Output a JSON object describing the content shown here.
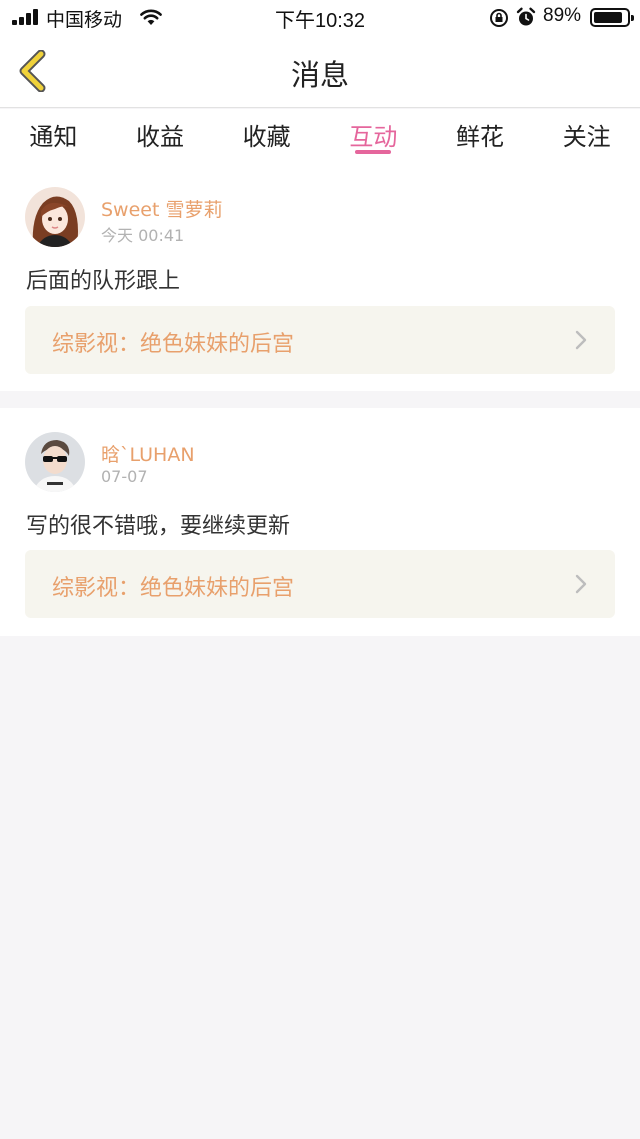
{
  "status_bar": {
    "carrier": "中国移动",
    "time": "下午10:32",
    "battery_percent": "89%",
    "battery_level": 0.89,
    "icons": [
      "signal-icon",
      "wifi-icon",
      "rotation-lock-icon",
      "alarm-icon",
      "battery-icon"
    ]
  },
  "nav": {
    "title": "消息",
    "back_icon": "chevron-left-icon",
    "accent_color": "#f0d23a"
  },
  "tabs": [
    {
      "label": "通知",
      "active": false
    },
    {
      "label": "收益",
      "active": false
    },
    {
      "label": "收藏",
      "active": false
    },
    {
      "label": "互动",
      "active": true
    },
    {
      "label": "鲜花",
      "active": false
    },
    {
      "label": "关注",
      "active": false
    }
  ],
  "colors": {
    "active_tab": "#e5669c",
    "username": "#e8a06c",
    "book_title": "#e8a06c",
    "book_bg": "#f6f5ee",
    "timestamp": "#b2b2b2",
    "page_bg": "#f6f5f7"
  },
  "messages": [
    {
      "username": "Sweet 雪萝莉",
      "time": "今天 00:41",
      "comment": "后面的队形跟上",
      "book_title": "综影视：绝色妹妹的后宫",
      "avatar_icon": "avatar-anime-girl"
    },
    {
      "username": "晗`LUHAN",
      "time": "07-07",
      "comment": "写的很不错哦，要继续更新",
      "book_title": "综影视：绝色妹妹的后宫",
      "avatar_icon": "avatar-man-sunglasses"
    }
  ]
}
